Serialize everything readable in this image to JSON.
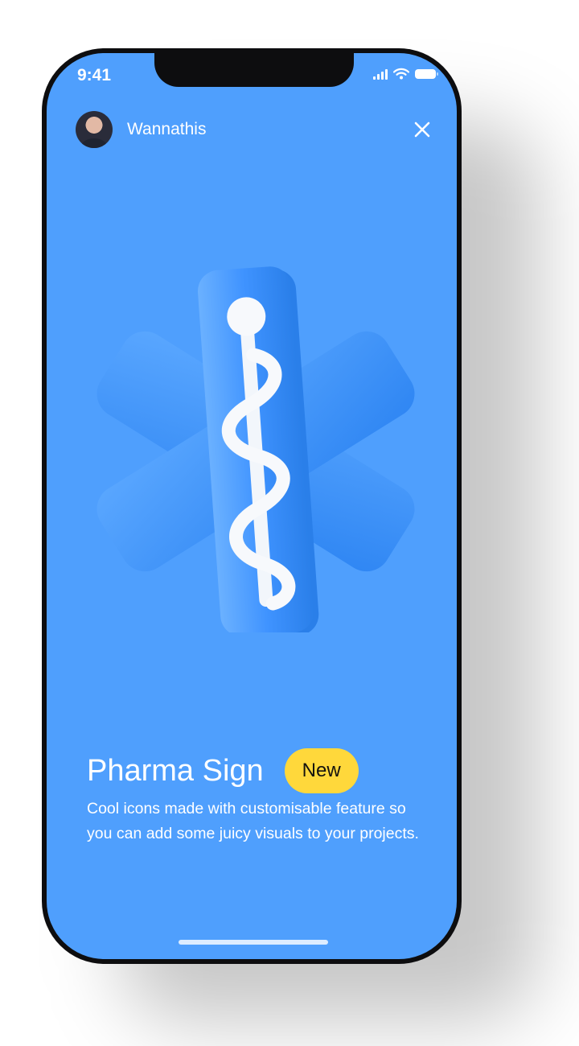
{
  "status": {
    "time": "9:41"
  },
  "header": {
    "username": "Wannathis",
    "avatar_icon": "user-avatar",
    "close_icon": "close-icon"
  },
  "card": {
    "title": "Pharma Sign",
    "badge": "New",
    "description": "Cool icons made with customisable feature so you can add some juicy visuals to your projects."
  },
  "illustration": {
    "icon": "rod-of-asclepius-cross-icon"
  },
  "colors": {
    "background": "#4f9ffd",
    "cross": "#3f93ff",
    "badge": "#ffd83b",
    "text": "#ffffff"
  }
}
